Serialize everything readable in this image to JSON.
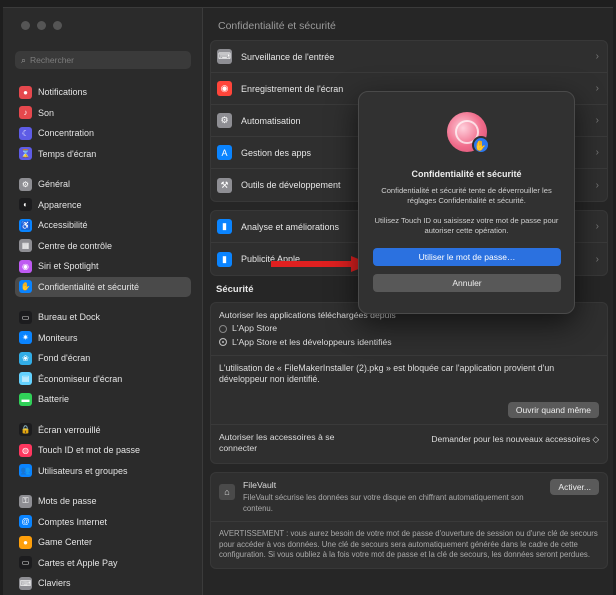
{
  "window": {
    "title": "Confidentialité et sécurité"
  },
  "search": {
    "placeholder": "Rechercher"
  },
  "sidebar": {
    "items": [
      {
        "label": "Notifications",
        "color": "#e5484d",
        "glyph": "●"
      },
      {
        "label": "Son",
        "color": "#e5484d",
        "glyph": "♪"
      },
      {
        "label": "Concentration",
        "color": "#5e5ce6",
        "glyph": "☾"
      },
      {
        "label": "Temps d'écran",
        "color": "#5e5ce6",
        "glyph": "⌛"
      },
      {
        "label": "Général",
        "color": "#8e8e93",
        "glyph": "⚙"
      },
      {
        "label": "Apparence",
        "color": "#1c1c1e",
        "glyph": "◐"
      },
      {
        "label": "Accessibilité",
        "color": "#0a84ff",
        "glyph": "♿"
      },
      {
        "label": "Centre de contrôle",
        "color": "#8e8e93",
        "glyph": "▦"
      },
      {
        "label": "Siri et Spotlight",
        "color": "#bf5af2",
        "glyph": "◉"
      },
      {
        "label": "Confidentialité et sécurité",
        "color": "#0a84ff",
        "glyph": "✋",
        "active": true
      },
      {
        "label": "Bureau et Dock",
        "color": "#1c1c1e",
        "glyph": "▭"
      },
      {
        "label": "Moniteurs",
        "color": "#0a84ff",
        "glyph": "✷"
      },
      {
        "label": "Fond d'écran",
        "color": "#32ade6",
        "glyph": "❀"
      },
      {
        "label": "Économiseur d'écran",
        "color": "#64d2ff",
        "glyph": "▤"
      },
      {
        "label": "Batterie",
        "color": "#30d158",
        "glyph": "▬"
      },
      {
        "label": "Écran verrouillé",
        "color": "#1c1c1e",
        "glyph": "🔒"
      },
      {
        "label": "Touch ID et mot de passe",
        "color": "#ff375f",
        "glyph": "◍"
      },
      {
        "label": "Utilisateurs et groupes",
        "color": "#0a84ff",
        "glyph": "👥"
      },
      {
        "label": "Mots de passe",
        "color": "#8e8e93",
        "glyph": "⚿"
      },
      {
        "label": "Comptes Internet",
        "color": "#0a84ff",
        "glyph": "@"
      },
      {
        "label": "Game Center",
        "color": "#ff9f0a",
        "glyph": "●"
      },
      {
        "label": "Cartes et Apple Pay",
        "color": "#1c1c1e",
        "glyph": "▭"
      },
      {
        "label": "Claviers",
        "color": "#8e8e93",
        "glyph": "⌨"
      }
    ]
  },
  "privacy": {
    "rows": [
      {
        "label": "Surveillance de l'entrée",
        "color": "#8e8e93",
        "glyph": "⌨"
      },
      {
        "label": "Enregistrement de l'écran",
        "color": "#ff453a",
        "glyph": "◉"
      },
      {
        "label": "Automatisation",
        "color": "#8e8e93",
        "glyph": "⚙"
      },
      {
        "label": "Gestion des apps",
        "color": "#0a84ff",
        "glyph": "A"
      },
      {
        "label": "Outils de développement",
        "color": "#8e8e93",
        "glyph": "⚒"
      }
    ],
    "rows2": [
      {
        "label": "Analyse et améliorations",
        "color": "#0a84ff",
        "glyph": "▮"
      },
      {
        "label": "Publicité Apple",
        "color": "#0a84ff",
        "glyph": "▮"
      }
    ]
  },
  "security": {
    "heading": "Sécurité",
    "allow_label": "Autoriser les applications téléchargées depuis",
    "option1": "L'App Store",
    "option2": "L'App Store et les développeurs identifiés",
    "blocked_text": "L'utilisation de « FileMakerInstaller (2).pkg » est bloquée car l'application provient d'un développeur non identifié.",
    "open_anyway": "Ouvrir quand même",
    "accessories_label": "Autoriser les accessoires à se connecter",
    "accessories_value": "Demander pour les nouveaux accessoires ◇",
    "filevault_title": "FileVault",
    "filevault_desc": "FileVault sécurise les données sur votre disque en chiffrant automatiquement son contenu.",
    "activate": "Activer...",
    "warning": "AVERTISSEMENT : vous aurez besoin de votre mot de passe d'ouverture de session ou d'une clé de secours pour accéder à vos données. Une clé de secours sera automatiquement générée dans le cadre de cette configuration. Si vous oubliez à la fois votre mot de passe et la clé de secours, les données seront perdues."
  },
  "dialog": {
    "title": "Confidentialité et sécurité",
    "message": "Confidentialité et sécurité tente de déverrouiller les réglages Confidentialité et sécurité.",
    "instruction": "Utilisez Touch ID ou saisissez votre mot de passe pour autoriser cette opération.",
    "primary": "Utiliser le mot de passe…",
    "secondary": "Annuler"
  },
  "arrow_color": "#e02020"
}
